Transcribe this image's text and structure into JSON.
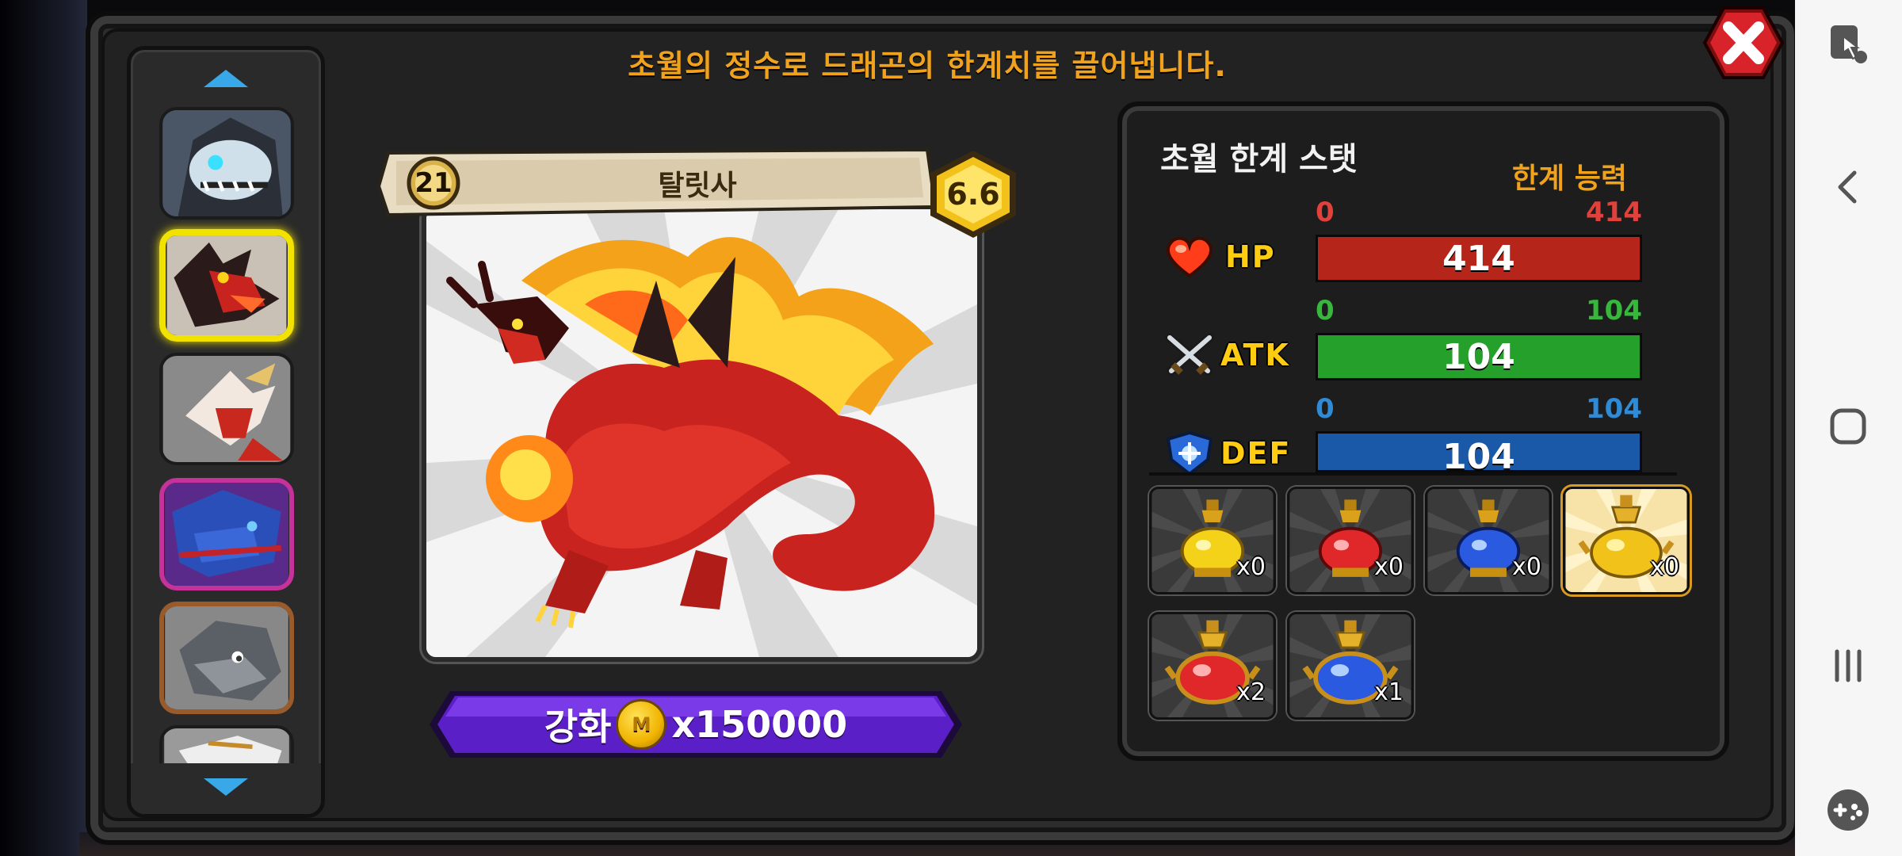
{
  "header": {
    "title": "초월의 정수로 드래곤의 한계치를 끌어냅니다."
  },
  "dragon": {
    "level": "21",
    "name": "탈릿사",
    "grade": "6.6"
  },
  "upgrade": {
    "label": "강화",
    "coin_symbol": "M",
    "cost": "x150000"
  },
  "stats": {
    "title": "초월 한계 스탯",
    "subtitle": "한계 능력",
    "rows": [
      {
        "name": "HP",
        "min": "0",
        "max": "414",
        "value": "414",
        "fill": 1.0,
        "color": "#b5251a",
        "label_color": "#e2403a",
        "icon": "heart-icon"
      },
      {
        "name": "ATK",
        "min": "0",
        "max": "104",
        "value": "104",
        "fill": 1.0,
        "color": "#25a02a",
        "label_color": "#37b83c",
        "icon": "crossed-swords-icon"
      },
      {
        "name": "DEF",
        "min": "0",
        "max": "104",
        "value": "104",
        "fill": 1.0,
        "color": "#1a58a8",
        "label_color": "#2f8bd6",
        "icon": "shield-icon"
      }
    ]
  },
  "items": [
    {
      "icon": "yellow-potion-icon",
      "count": "x0",
      "selected": false
    },
    {
      "icon": "red-potion-icon",
      "count": "x0",
      "selected": false
    },
    {
      "icon": "blue-potion-icon",
      "count": "x0",
      "selected": false
    },
    {
      "icon": "gold-potion-icon",
      "count": "x0",
      "selected": true
    },
    {
      "icon": "red-ornate-potion-icon",
      "count": "x2",
      "selected": false
    },
    {
      "icon": "blue-ornate-potion-icon",
      "count": "x1",
      "selected": false
    }
  ],
  "dragon_list": [
    {
      "icon": "skeleton-dragon-icon",
      "frame": "#1b1b1b",
      "selected": false
    },
    {
      "icon": "fire-dragon-icon",
      "frame": "#f2e200",
      "selected": true
    },
    {
      "icon": "white-red-dragon-icon",
      "frame": "#1b1b1b",
      "selected": false
    },
    {
      "icon": "blue-dragon-icon",
      "frame": "#c4329a",
      "selected": false
    },
    {
      "icon": "rock-dragon-icon",
      "frame": "#9a5a2a",
      "selected": false
    },
    {
      "icon": "white-dragon-icon",
      "frame": "#1b1b1b",
      "selected": false
    }
  ],
  "android_nav": {
    "icons": [
      "screen-touch-icon",
      "back-icon",
      "home-icon",
      "recents-icon",
      "game-tools-icon"
    ]
  }
}
